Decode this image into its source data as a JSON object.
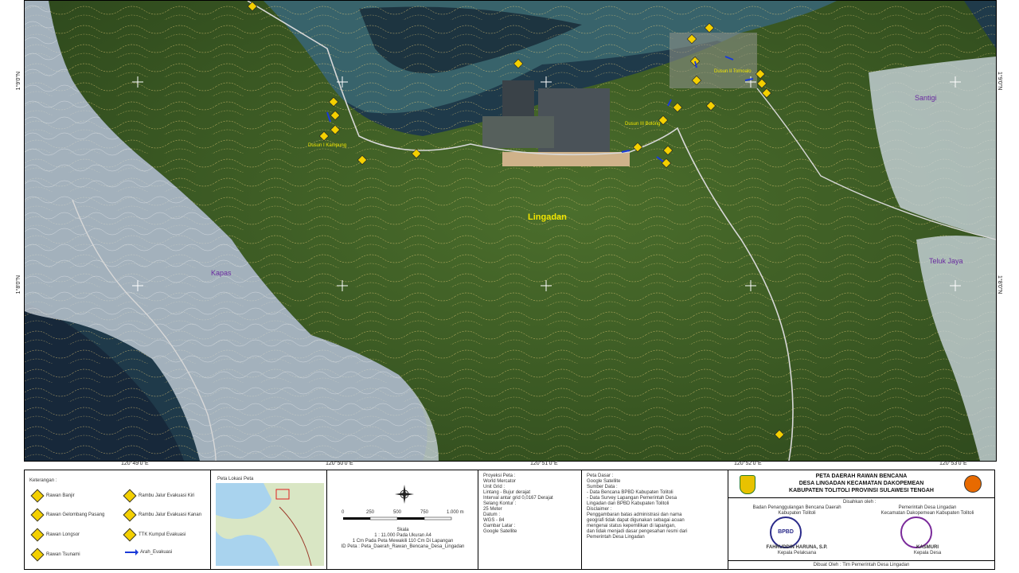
{
  "map": {
    "places": {
      "lingadan": "Lingadan",
      "kapas": "Kapas",
      "santigi": "Santigi",
      "teluk_jaya": "Teluk Jaya",
      "dusun_kampung": "Dusun I Kampung",
      "dusun_tomoalo": "Dusun II Tomoalo",
      "dusun_bolong": "Dusun III Bolong"
    },
    "longitudes": [
      "120°49'0\"E",
      "120°50'0\"E",
      "120°51'0\"E",
      "120°52'0\"E",
      "120°53'0\"E"
    ],
    "latitudes": [
      "1°9'0\"N",
      "1°8'0\"N"
    ],
    "colors": {
      "vegetation": "#3c5a24",
      "sea": "#1e3b4a",
      "shallow": "#4e7e84",
      "contour": "#f2d37a",
      "overlay": "#c9d4dc"
    }
  },
  "legend": {
    "title": "Keterangan :",
    "items": [
      {
        "icon": "flood-sign-icon",
        "label": "Rawan Banjir"
      },
      {
        "icon": "wave-sign-icon",
        "label": "Rawan Gelombang Pasang"
      },
      {
        "icon": "landslide-sign-icon",
        "label": "Rawan Longsor"
      },
      {
        "icon": "tsunami-sign-icon",
        "label": "Rawan Tsunami"
      },
      {
        "icon": "evacuation-left-sign-icon",
        "label": "Rambu Jalur Evakuasi Kiri"
      },
      {
        "icon": "evacuation-right-sign-icon",
        "label": "Rambu Jalur Evakuasi Kanan"
      },
      {
        "icon": "muster-point-sign-icon",
        "label": "TTK Kumpul Evakuasi"
      },
      {
        "icon": "route-arrow-icon",
        "label": "Arah_Evakuasi"
      }
    ]
  },
  "inset": {
    "title": "Peta Lokasi Peta"
  },
  "scale": {
    "ticks": [
      "0",
      "250",
      "500",
      "750",
      "1.000 m"
    ],
    "lines": [
      "Skala",
      "1 : 11.000 Pada Ukuran A4",
      "1 Cm Pada Peta Mewakili 110 Cm Di Lapangan",
      "ID Peta : Peta_Daerah_Rawan_Bencana_Desa_Lingadan"
    ]
  },
  "projection": {
    "lines": [
      "Proyeksi Peta :",
      "World Mercator",
      "",
      "Unit Grid :",
      "Lintang - Bujur derajat",
      "Interval antar grid 0,0167 Derajat",
      "",
      "Selang Kontur :",
      "25 Meter",
      "",
      "Datum :",
      "WGS - 84",
      "",
      "Gambar Latar :",
      "Google Satellite"
    ]
  },
  "source": {
    "lines": [
      "Peta Dasar :",
      "Google Satellite",
      "",
      "Sumber Data :",
      "- Data Bencana BPBD Kabupaten Tolitoli",
      "- Data Survey Lapangan Pemerintah Desa",
      "  Lingadan dan BPBD Kabupaten Tolitoli",
      "",
      "Disclaimer :",
      "Penggambaran batas administrasi dan nama",
      "geografi tidak dapat digunakan sebagai acuan",
      "mengenai status kepemilikan di lapangan,",
      "dan tidak menjadi dasar pengesahan resmi dari",
      "Pemerintah Desa Lingadan"
    ]
  },
  "title_block": {
    "lines": [
      "PETA DAERAH RAWAN BENCANA",
      "DESA LINGADAN KECAMATAN DAKOPEMEAN",
      "KABUPATEN TOLITOLI PROVINSI SULAWESI TENGAH"
    ],
    "disahkan": "Disahkan oleh :",
    "left_org": [
      "Badan Penanggulangan Bencana Daerah",
      "Kabupaten Tolitoli"
    ],
    "right_org": [
      "Pemerintah Desa Lingadan",
      "Kecamatan Dakopemean Kabupaten Tolitoli"
    ],
    "left_stamp": "BPBD",
    "left_sign": [
      "FAHRUDDIN HARUNA, S.P.",
      "Kepala Pelaksana"
    ],
    "right_sign": [
      "KASMURI",
      "Kepala Desa"
    ],
    "footer": "Dibuat Oleh : Tim Pemerintah Desa Lingadan"
  }
}
